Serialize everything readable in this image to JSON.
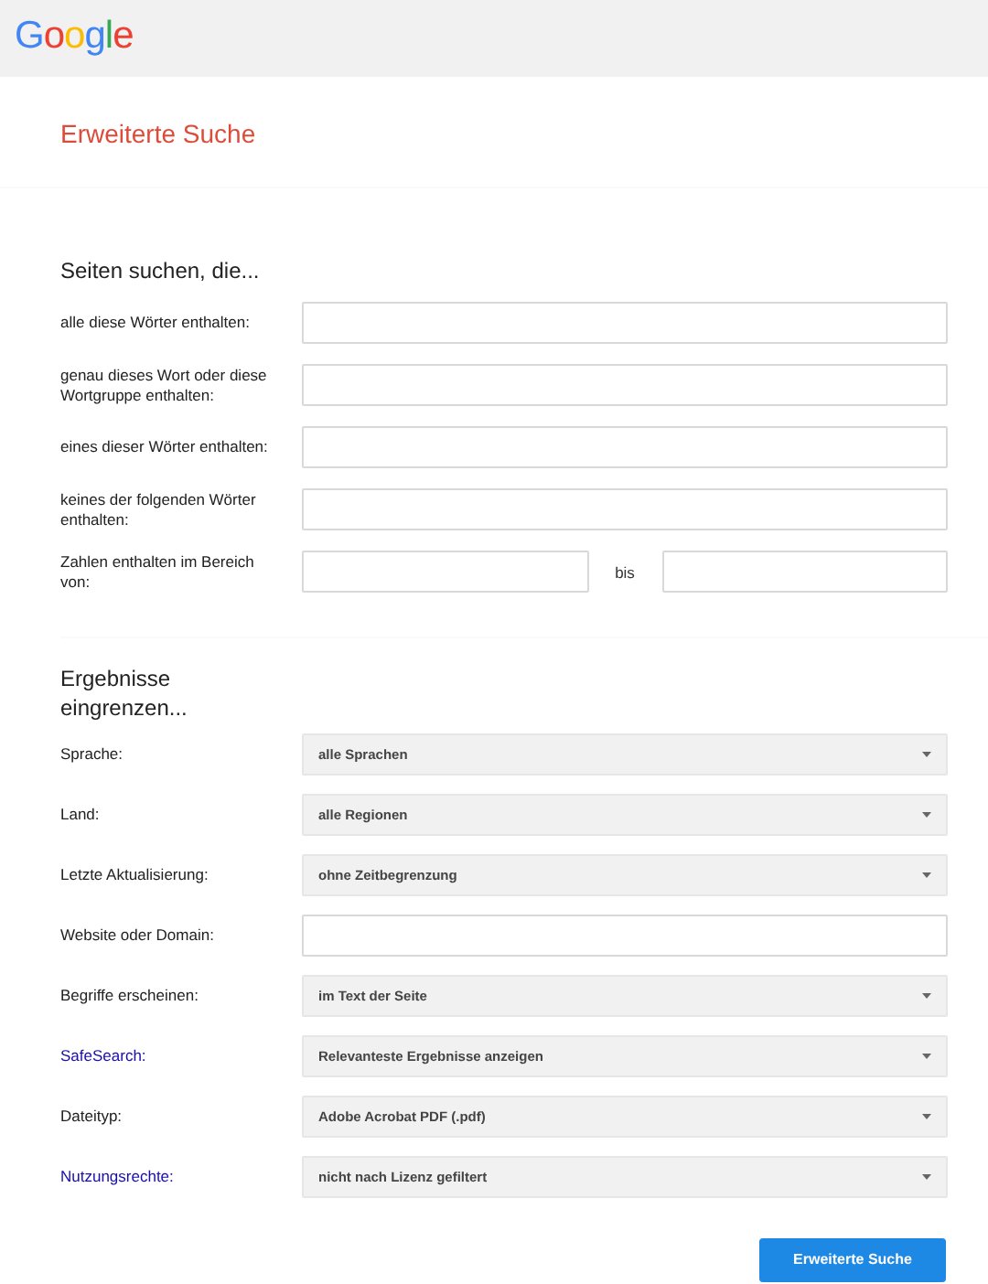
{
  "header": {
    "logo": "Google"
  },
  "title": "Erweiterte Suche",
  "sections": [
    {
      "heading": "Seiten suchen, die...",
      "rows": [
        {
          "kind": "text",
          "label": "alle diese Wörter enthalten:",
          "label_link": false
        },
        {
          "kind": "text",
          "label": "genau dieses Wort oder diese Wortgruppe enthalten:",
          "label_link": false
        },
        {
          "kind": "text",
          "label": "eines dieser Wörter enthalten:",
          "label_link": false
        },
        {
          "kind": "text",
          "label": "keines der folgenden Wörter enthalten:",
          "label_link": false
        },
        {
          "kind": "range",
          "label": "Zahlen enthalten im Bereich von:",
          "label_link": false,
          "separator": "bis"
        }
      ]
    },
    {
      "heading": "Ergebnisse eingrenzen...",
      "rows": [
        {
          "kind": "select",
          "label": "Sprache:",
          "label_link": false,
          "value": "alle Sprachen"
        },
        {
          "kind": "select",
          "label": "Land:",
          "label_link": false,
          "value": "alle Regionen"
        },
        {
          "kind": "select",
          "label": "Letzte Aktualisierung:",
          "label_link": false,
          "value": "ohne Zeitbegrenzung"
        },
        {
          "kind": "text",
          "label": "Website oder Domain:",
          "label_link": false
        },
        {
          "kind": "select",
          "label": "Begriffe erscheinen:",
          "label_link": false,
          "value": "im Text der Seite"
        },
        {
          "kind": "select",
          "label": "SafeSearch:",
          "label_link": true,
          "value": "Relevanteste Ergebnisse anzeigen"
        },
        {
          "kind": "select",
          "label": "Dateityp:",
          "label_link": false,
          "value": "Adobe Acrobat PDF (.pdf)"
        },
        {
          "kind": "select",
          "label": "Nutzungsrechte:",
          "label_link": true,
          "value": "nicht nach Lizenz gefiltert"
        }
      ]
    }
  ],
  "submit": "Erweiterte Suche"
}
